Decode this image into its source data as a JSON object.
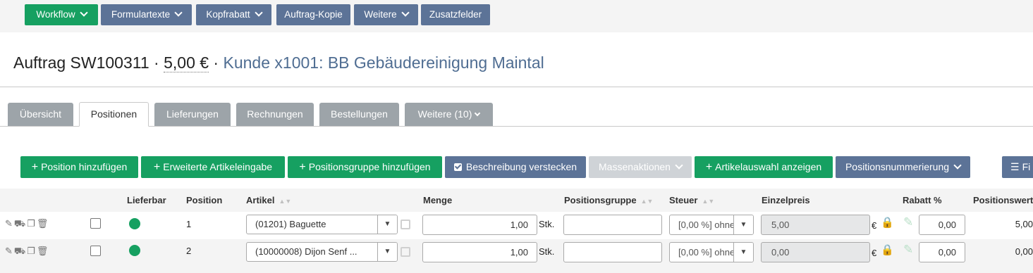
{
  "toolbar": {
    "workflow": "Workflow",
    "formulartexte": "Formulartexte",
    "kopfrabatt": "Kopfrabatt",
    "auftrag_kopie": "Auftrag-Kopie",
    "weitere": "Weitere",
    "zusatzfelder": "Zusatzfelder"
  },
  "header": {
    "order": "Auftrag SW100311",
    "sep1": " · ",
    "amount": "5,00 €",
    "sep2": " · ",
    "customer": "Kunde x1001: BB Gebäudereinigung Maintal"
  },
  "tabs": {
    "uebersicht": "Übersicht",
    "positionen": "Positionen",
    "lieferungen": "Lieferungen",
    "rechnungen": "Rechnungen",
    "bestellungen": "Bestellungen",
    "weitere": "Weitere (10)"
  },
  "actions": {
    "add_position": "Position hinzufügen",
    "extended_entry": "Erweiterte Artikeleingabe",
    "add_group": "Positionsgruppe hinzufügen",
    "hide_description": "Beschreibung verstecken",
    "mass_actions": "Massenaktionen",
    "show_article_selection": "Artikelauswahl anzeigen",
    "numbering": "Positionsnummerierung",
    "filter": "Fi"
  },
  "table": {
    "headers": {
      "lieferbar": "Lieferbar",
      "position": "Position",
      "artikel": "Artikel",
      "menge": "Menge",
      "positionsgruppe": "Positionsgruppe",
      "steuer": "Steuer",
      "einzelpreis": "Einzelpreis",
      "rabatt": "Rabatt %",
      "positionswert": "Positionswert"
    },
    "rows": [
      {
        "position": "1",
        "artikel": "(01201) Baguette",
        "menge": "1,00",
        "unit": "Stk.",
        "gruppe": "",
        "steuer": "[0,00 %] ohne",
        "einzelpreis": "5,00",
        "currency": "€",
        "rabatt": "0,00",
        "wert": "5,00"
      },
      {
        "position": "2",
        "artikel": "(10000008) Dijon Senf ...",
        "menge": "1,00",
        "unit": "Stk.",
        "gruppe": "",
        "steuer": "[0,00 %] ohne",
        "einzelpreis": "0,00",
        "currency": "€",
        "rabatt": "0,00",
        "wert": "0,00"
      }
    ]
  },
  "colors": {
    "green": "#16a061",
    "slate": "#5c7397",
    "tab_grey": "#9da4a9",
    "link": "#4f6d92"
  }
}
